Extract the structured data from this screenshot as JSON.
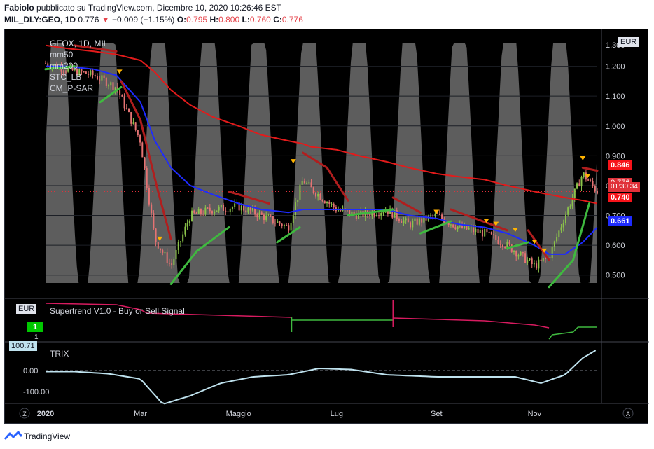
{
  "header": {
    "author": "Fabiolo",
    "published": "pubblicato su TradingView.com, Dicembre 10, 2020 10:26:46 EST",
    "symbol_line": "MIL_DLY:GEO, 1D",
    "last": "0.776",
    "change": "−0.009 (−1.15%)",
    "o_label": "O:",
    "o_value": "0.795",
    "h_label": "H:",
    "h_value": "0.800",
    "l_label": "L:",
    "l_value": "0.760",
    "c_label": "C:",
    "c_value": "0.776"
  },
  "main_legend": {
    "title": "GEOX, 1D, MIL",
    "items": [
      "mm50",
      "mm200",
      "STC_LB",
      "CM_P-SAR"
    ]
  },
  "price_axis": {
    "currency": "EUR",
    "top_value": "1.300",
    "ticks": [
      "1.200",
      "1.100",
      "1.000",
      "0.900",
      "0.800",
      "0.700",
      "0.600",
      "0.500"
    ]
  },
  "price_badges": {
    "mm200": "0.846",
    "last_price": "0.776",
    "countdown": "01:30:34",
    "sar": "0.740",
    "mm50": "0.661"
  },
  "supertrend": {
    "legend": "Supertrend V1.0 - Buy or Sell Signal",
    "currency": "EUR",
    "badge": "1",
    "ticks": [
      "1",
      "1"
    ]
  },
  "trix": {
    "legend": "TRIX",
    "badge": "100.71",
    "ticks": [
      "0.00",
      "-100.00"
    ]
  },
  "time_axis": {
    "labels": [
      "2020",
      "Mar",
      "Maggio",
      "Lug",
      "Set",
      "Nov"
    ]
  },
  "footer": {
    "brand": "TradingView"
  },
  "colors": {
    "background": "#000000",
    "mm50": "#1e2bff",
    "mm200": "#e31b1b",
    "sar_bull": "#3fb93f",
    "sar_bear": "#b01e1e",
    "stc_fill": "#6d6d6d",
    "trix": "#bfe2ee"
  },
  "chart_data": [
    {
      "type": "candlestick",
      "title": "GEOX, 1D, MIL",
      "ylim": [
        0.45,
        1.3
      ],
      "x": [
        "2020-01-02",
        "2020-01-15",
        "2020-02-01",
        "2020-02-15",
        "2020-03-01",
        "2020-03-10",
        "2020-03-20",
        "2020-04-01",
        "2020-04-15",
        "2020-05-01",
        "2020-05-15",
        "2020-06-01",
        "2020-06-10",
        "2020-06-15",
        "2020-07-01",
        "2020-07-15",
        "2020-08-01",
        "2020-08-15",
        "2020-09-01",
        "2020-09-15",
        "2020-10-01",
        "2020-10-15",
        "2020-11-01",
        "2020-11-10",
        "2020-11-20",
        "2020-12-01",
        "2020-12-10"
      ],
      "close": [
        1.21,
        1.19,
        1.17,
        1.13,
        0.95,
        0.62,
        0.53,
        0.7,
        0.72,
        0.73,
        0.7,
        0.66,
        0.82,
        0.79,
        0.72,
        0.7,
        0.72,
        0.67,
        0.7,
        0.66,
        0.64,
        0.6,
        0.53,
        0.56,
        0.7,
        0.84,
        0.78
      ],
      "series": [
        {
          "name": "mm50",
          "values": [
            1.2,
            1.2,
            1.19,
            1.17,
            1.08,
            0.95,
            0.86,
            0.8,
            0.77,
            0.74,
            0.72,
            0.71,
            0.72,
            0.72,
            0.72,
            0.72,
            0.72,
            0.7,
            0.69,
            0.67,
            0.66,
            0.64,
            0.6,
            0.57,
            0.57,
            0.61,
            0.66
          ]
        },
        {
          "name": "mm200",
          "values": [
            1.27,
            1.26,
            1.25,
            1.24,
            1.22,
            1.18,
            1.12,
            1.07,
            1.03,
            1.0,
            0.97,
            0.95,
            0.94,
            0.93,
            0.92,
            0.9,
            0.88,
            0.86,
            0.84,
            0.83,
            0.82,
            0.8,
            0.78,
            0.77,
            0.76,
            0.75,
            0.74
          ]
        }
      ]
    },
    {
      "type": "line",
      "title": "Supertrend V1.0 - Buy or Sell Signal",
      "x": [
        "2020-01-02",
        "2020-03-01",
        "2020-05-01",
        "2020-06-10",
        "2020-08-01",
        "2020-10-01",
        "2020-11-10",
        "2020-12-10"
      ],
      "values": [
        1,
        1,
        1,
        -1,
        1,
        1,
        -1,
        -1
      ]
    },
    {
      "type": "line",
      "title": "TRIX",
      "ylim": [
        -150,
        130
      ],
      "x": [
        "2020-01-02",
        "2020-01-20",
        "2020-02-10",
        "2020-03-01",
        "2020-03-15",
        "2020-04-01",
        "2020-04-20",
        "2020-05-10",
        "2020-06-01",
        "2020-06-20",
        "2020-07-10",
        "2020-08-01",
        "2020-09-01",
        "2020-10-01",
        "2020-10-20",
        "2020-11-05",
        "2020-11-20",
        "2020-12-01",
        "2020-12-10"
      ],
      "values": [
        -5,
        -5,
        -15,
        -40,
        -160,
        -120,
        -60,
        -30,
        -20,
        10,
        5,
        -20,
        -30,
        -30,
        -30,
        -60,
        -20,
        60,
        100.71
      ]
    }
  ]
}
